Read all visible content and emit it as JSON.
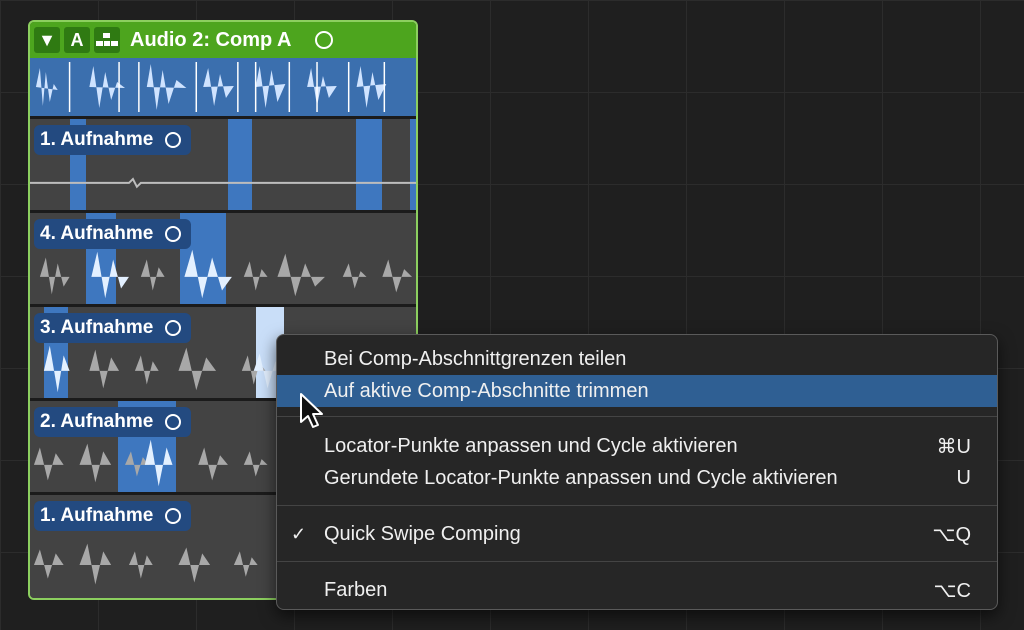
{
  "folder": {
    "buttons": {
      "disclosure": "▼",
      "automation": "A"
    },
    "title": "Audio 2: Comp A"
  },
  "takes": [
    {
      "label": "1. Aufnahme"
    },
    {
      "label": "4. Aufnahme"
    },
    {
      "label": "3. Aufnahme"
    },
    {
      "label": "2. Aufnahme"
    },
    {
      "label": "1. Aufnahme"
    }
  ],
  "context_menu": {
    "items": [
      {
        "label": "Bei Comp-Abschnittgrenzen teilen",
        "shortcut": ""
      },
      {
        "label": "Auf aktive Comp-Abschnitte trimmen",
        "shortcut": ""
      },
      {
        "label": "Locator-Punkte anpassen und Cycle aktivieren",
        "shortcut": "⌘U"
      },
      {
        "label": "Gerundete Locator-Punkte anpassen und Cycle aktivieren",
        "shortcut": "U"
      },
      {
        "label": "Quick Swipe Comping",
        "shortcut": "⌥Q",
        "checkmark": "✓"
      },
      {
        "label": "Farben",
        "shortcut": "⌥C"
      }
    ]
  },
  "colors": {
    "folder_header": "#4da51e",
    "selection": "#3e77bf",
    "menu_highlight": "#2f5f93"
  }
}
